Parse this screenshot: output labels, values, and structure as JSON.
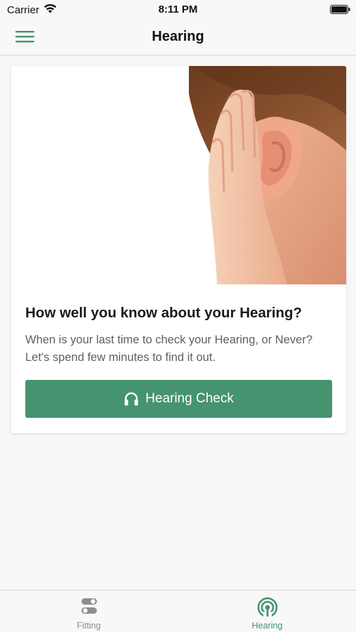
{
  "status_bar": {
    "carrier": "Carrier",
    "time": "8:11 PM"
  },
  "nav": {
    "title": "Hearing",
    "menu_icon": "hamburger-menu-icon"
  },
  "card": {
    "image": "child-cupping-ear-photo",
    "title": "How well you know about your Hearing?",
    "description": "When is your last time to check your Hearing, or Never? Let's spend few minutes to find it out.",
    "button_label": "Hearing Check",
    "button_icon": "headphones-icon"
  },
  "tabs": [
    {
      "label": "Fitting",
      "icon": "toggle-switches-icon",
      "active": false
    },
    {
      "label": "Hearing",
      "icon": "broadcast-icon",
      "active": true
    }
  ],
  "colors": {
    "accent": "#45936f",
    "inactive_tab": "#8e8e8e",
    "background": "#f7f7f7"
  }
}
